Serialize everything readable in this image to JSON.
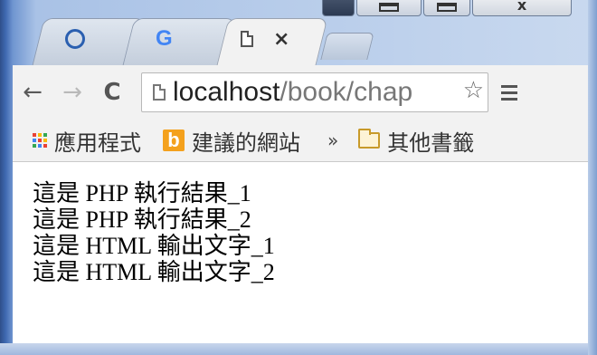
{
  "window": {
    "controls": {
      "minimize_icon": "minimize-icon",
      "maximize_icon": "maximize-icon",
      "close_label": "x"
    }
  },
  "tabs": [
    {
      "icon": "ring-logo-icon",
      "label": ""
    },
    {
      "icon": "google-g-icon",
      "glyph": "G"
    },
    {
      "icon": "document-icon",
      "close": "×",
      "active": true
    }
  ],
  "toolbar": {
    "back_glyph": "←",
    "forward_glyph": "→",
    "reload_glyph": "C",
    "url_host": "localhost",
    "url_path": "/book/chap",
    "star_glyph": "☆",
    "menu_icon": "hamburger-menu-icon"
  },
  "bookmarks": {
    "apps_label": "應用程式",
    "suggested_label": "建議的網站",
    "bing_glyph": "b",
    "overflow_glyph": "»",
    "other_label": "其他書籤"
  },
  "content": {
    "lines": [
      "這是 PHP 執行結果_1",
      "這是 PHP 執行結果_2",
      "這是 HTML 輸出文字_1",
      "這是 HTML 輸出文字_2"
    ]
  },
  "colors": {
    "frame_blue": "#3e68b0",
    "chrome_gray": "#f2f2f2",
    "google_blue": "#4285f4",
    "bing_orange": "#f4a11d",
    "apps_dots": [
      "#e94235",
      "#fbbc05",
      "#34a853",
      "#4285f4",
      "#e94235",
      "#fbbc05",
      "#34a853",
      "#4285f4",
      "#e94235"
    ]
  }
}
